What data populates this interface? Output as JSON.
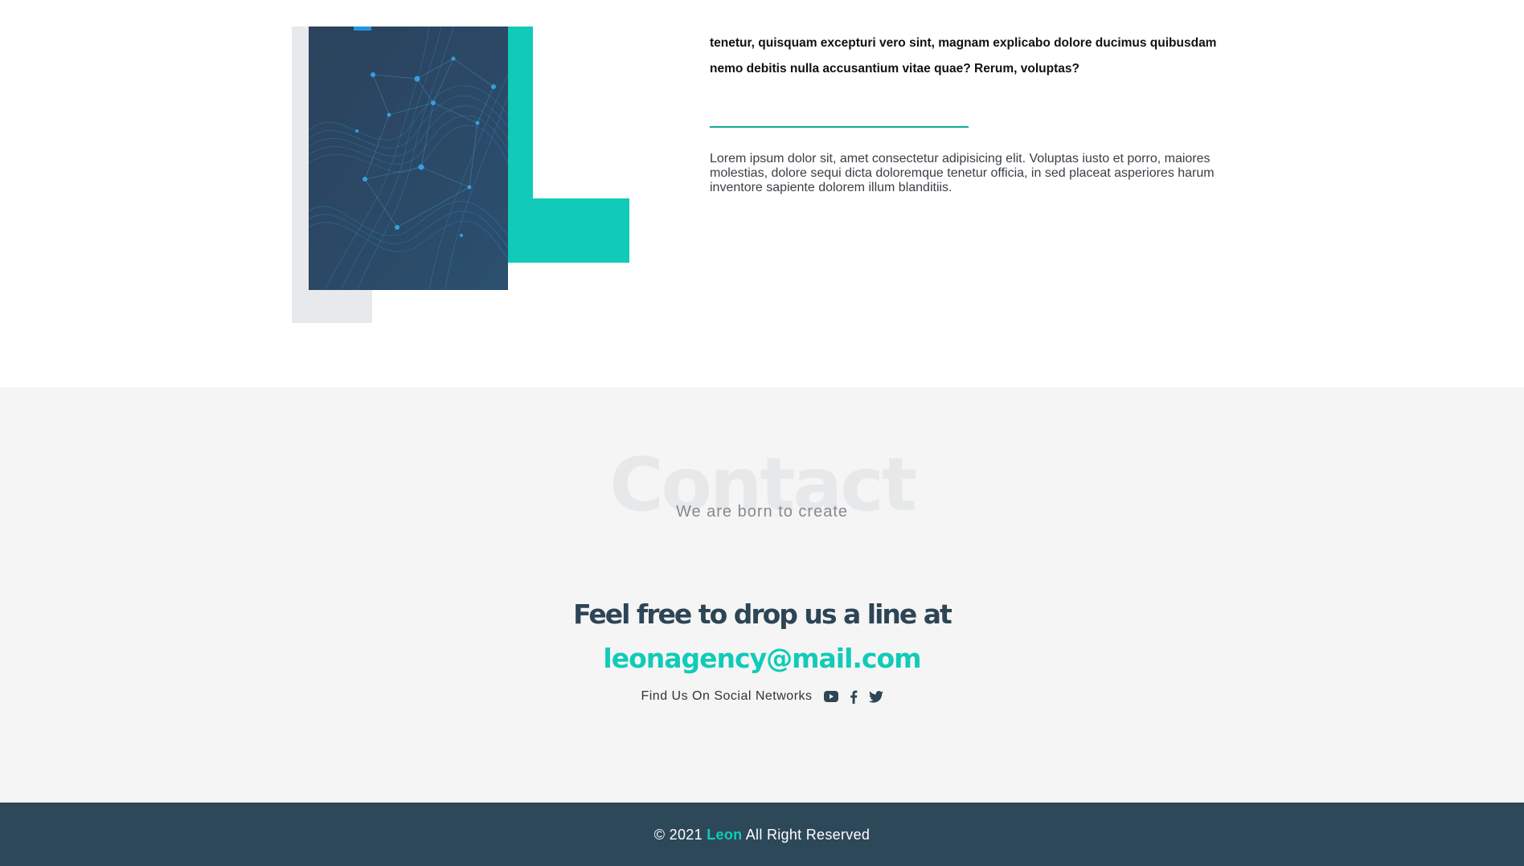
{
  "about": {
    "bold_text": "tenetur, quisquam excepturi vero sint, magnam explicabo dolore ducimus quibusdam nemo debitis nulla accusantium vitae quae? Rerum, voluptas?",
    "body_text": "Lorem ipsum dolor sit, amet consectetur adipisicing elit. Voluptas iusto et porro, maiores molestias, dolore sequi dicta doloremque tenetur officia, in sed placeat asperiores harum inventore sapiente dolorem illum blanditiis."
  },
  "contact": {
    "watermark": "Contact",
    "subtitle": "We are born to create",
    "heading": "Feel free to drop us a line at",
    "email": "leonagency@mail.com",
    "social_label": "Find Us On Social Networks",
    "social_icons": [
      "youtube-icon",
      "facebook-icon",
      "twitter-icon"
    ]
  },
  "footer": {
    "copyright_prefix": "© 2021",
    "brand": "Leon",
    "copyright_suffix": "All Right Reserved"
  },
  "colors": {
    "accent": "#11cbb8",
    "dark": "#2d4858",
    "heading": "#2d4554",
    "contact_bg": "#f5f5f5",
    "book_bg": "#2c3e55"
  }
}
